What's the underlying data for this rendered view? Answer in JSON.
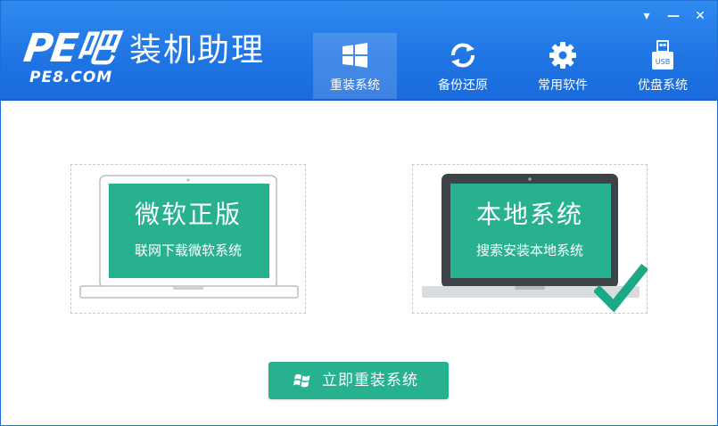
{
  "app": {
    "logo_mark": "PE吧",
    "title": "装机助理",
    "subtitle": "PE8.COM"
  },
  "window_controls": {
    "menu": "▾",
    "minimize": "—",
    "close": "✕"
  },
  "nav": [
    {
      "label": "重装系统",
      "icon": "windows-icon",
      "active": true
    },
    {
      "label": "备份还原",
      "icon": "sync-icon",
      "active": false
    },
    {
      "label": "常用软件",
      "icon": "gear-icon",
      "active": false
    },
    {
      "label": "优盘系统",
      "icon": "usb-drive-icon",
      "active": false
    }
  ],
  "usb_icon_text": "USB",
  "options": [
    {
      "title": "微软正版",
      "subtitle": "联网下载微软系统",
      "selected": false
    },
    {
      "title": "本地系统",
      "subtitle": "搜索安装本地系统",
      "selected": true
    }
  ],
  "install_button": {
    "label": "立即重装系统"
  },
  "colors": {
    "header_blue": "#1f74e3",
    "accent_green": "#27b18f",
    "check_green": "#1aa886"
  }
}
